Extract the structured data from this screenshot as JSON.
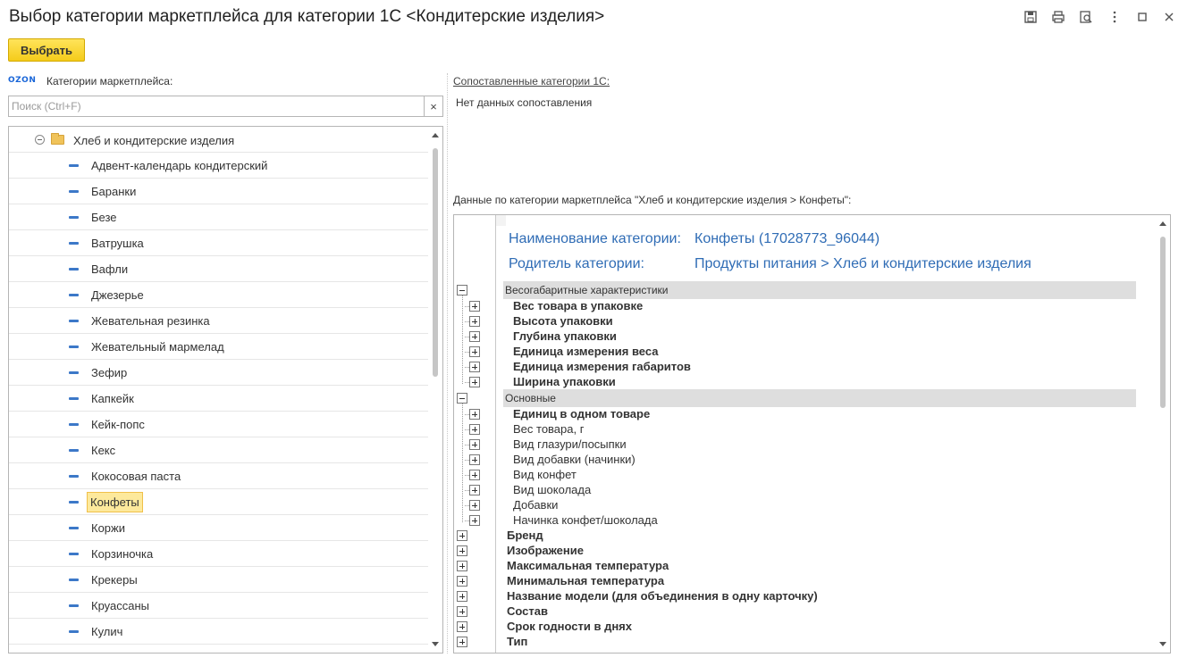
{
  "window": {
    "title": "Выбор категории маркетплейса для категории 1С <Кондитерские изделия>",
    "icons": [
      "save-icon",
      "print-icon",
      "preview-icon",
      "more-icon",
      "maximize-icon",
      "close-icon"
    ]
  },
  "toolbar": {
    "select_label": "Выбрать"
  },
  "left": {
    "logo": "OZON",
    "caption": "Категории маркетплейса:",
    "search_placeholder": "Поиск (Ctrl+F)",
    "clear_symbol": "×",
    "tree": {
      "root": "Хлеб и кондитерские изделия",
      "items": [
        "Адвент-календарь кондитерский",
        "Баранки",
        "Безе",
        "Ватрушка",
        "Вафли",
        "Джезерье",
        "Жевательная резинка",
        "Жевательный мармелад",
        "Зефир",
        "Капкейк",
        "Кейк-попс",
        "Кекс",
        "Кокосовая паста",
        "Конфеты",
        "Коржи",
        "Корзиночка",
        "Крекеры",
        "Круассаны",
        "Кулич"
      ],
      "selected": "Конфеты"
    }
  },
  "right": {
    "mapped_caption": "Сопоставленные категории 1С:",
    "no_data": "Нет данных сопоставления",
    "data_caption": "Данные по категории маркетплейса \"Хлеб и кондитерские изделия > Конфеты\":",
    "category_name_label": "Наименование категории:",
    "category_name_value": "Конфеты (17028773_96044)",
    "parent_label": "Родитель категории:",
    "parent_value": "Продукты питания > Хлеб и кондитерские изделия",
    "groups": [
      {
        "name": "Весогабаритные характеристики",
        "items": [
          {
            "label": "Вес товара в упаковке",
            "bold": true
          },
          {
            "label": "Высота упаковки",
            "bold": true
          },
          {
            "label": "Глубина упаковки",
            "bold": true
          },
          {
            "label": "Единица измерения веса",
            "bold": true
          },
          {
            "label": "Единица измерения габаритов",
            "bold": true
          },
          {
            "label": "Ширина упаковки",
            "bold": true
          }
        ]
      },
      {
        "name": "Основные",
        "items": [
          {
            "label": "Единиц в одном товаре",
            "bold": true
          },
          {
            "label": "Вес товара, г",
            "bold": false
          },
          {
            "label": "Вид глазури/посыпки",
            "bold": false
          },
          {
            "label": "Вид добавки (начинки)",
            "bold": false
          },
          {
            "label": "Вид конфет",
            "bold": false
          },
          {
            "label": "Вид шоколада",
            "bold": false
          },
          {
            "label": "Добавки",
            "bold": false
          },
          {
            "label": "Начинка конфет/шоколада",
            "bold": false
          }
        ]
      }
    ],
    "top_items": [
      "Бренд",
      "Изображение",
      "Максимальная температура",
      "Минимальная температура",
      "Название модели (для объединения в одну карточку)",
      "Состав",
      "Срок годности в днях",
      "Тип"
    ]
  }
}
